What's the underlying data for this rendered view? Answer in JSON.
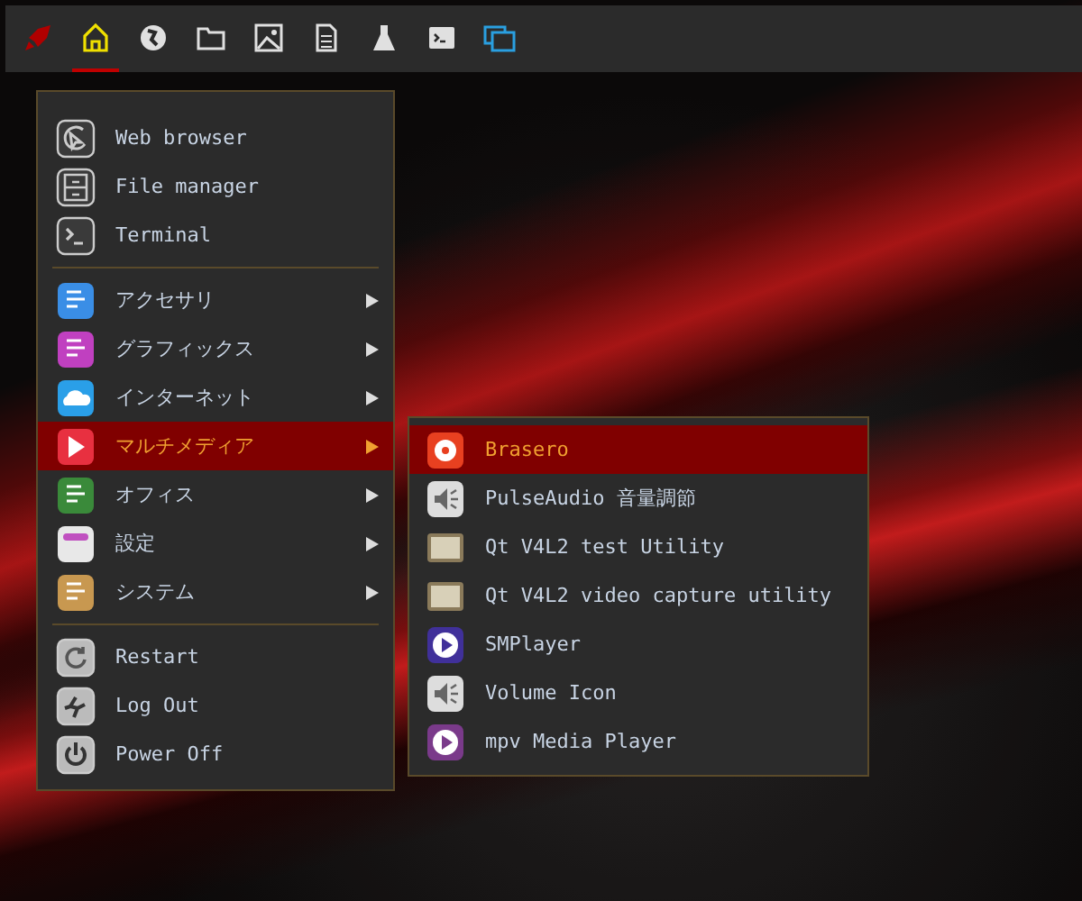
{
  "panel": {
    "launchers": [
      {
        "selected": false
      },
      {
        "selected": true
      },
      {
        "selected": false
      },
      {
        "selected": false
      },
      {
        "selected": false
      },
      {
        "selected": false
      },
      {
        "selected": false
      },
      {
        "selected": false
      },
      {
        "selected": false
      }
    ]
  },
  "menu": {
    "sections": [
      {
        "items": [
          {
            "label": "Web browser",
            "submenu": false,
            "selected": false
          },
          {
            "label": "File manager",
            "submenu": false,
            "selected": false
          },
          {
            "label": "Terminal",
            "submenu": false,
            "selected": false
          }
        ]
      },
      {
        "items": [
          {
            "label": "アクセサリ",
            "submenu": true,
            "selected": false
          },
          {
            "label": "グラフィックス",
            "submenu": true,
            "selected": false
          },
          {
            "label": "インターネット",
            "submenu": true,
            "selected": false
          },
          {
            "label": "マルチメディア",
            "submenu": true,
            "selected": true
          },
          {
            "label": "オフィス",
            "submenu": true,
            "selected": false
          },
          {
            "label": "設定",
            "submenu": true,
            "selected": false
          },
          {
            "label": "システム",
            "submenu": true,
            "selected": false
          }
        ]
      },
      {
        "items": [
          {
            "label": "Restart",
            "submenu": false,
            "selected": false
          },
          {
            "label": "Log Out",
            "submenu": false,
            "selected": false
          },
          {
            "label": "Power Off",
            "submenu": false,
            "selected": false
          }
        ]
      }
    ]
  },
  "submenu": {
    "items": [
      {
        "label": "Brasero",
        "selected": true
      },
      {
        "label": "PulseAudio 音量調節",
        "selected": false
      },
      {
        "label": "Qt V4L2 test Utility",
        "selected": false
      },
      {
        "label": "Qt V4L2 video capture utility",
        "selected": false
      },
      {
        "label": "SMPlayer",
        "selected": false
      },
      {
        "label": "Volume Icon",
        "selected": false
      },
      {
        "label": "mpv Media Player",
        "selected": false
      }
    ]
  }
}
